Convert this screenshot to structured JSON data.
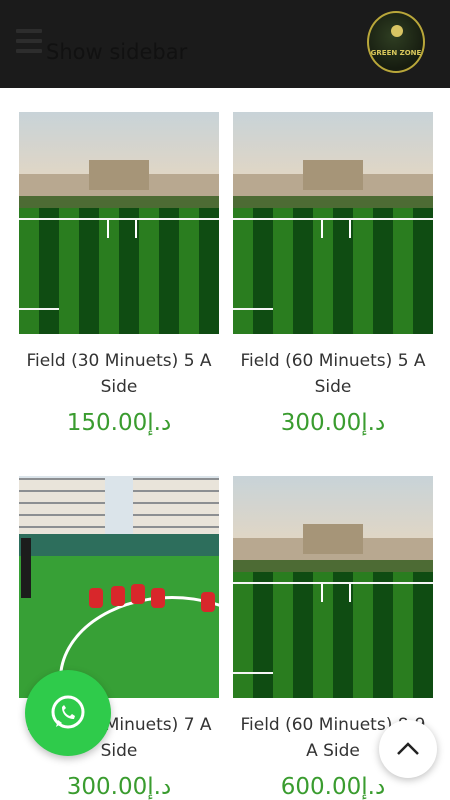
{
  "header": {
    "sidebar_label": "Show sidebar",
    "logo_text": "GREEN ZONE"
  },
  "products": [
    {
      "title": "Field (30 Minuets) 5 A Side",
      "price": "150.00د.إ"
    },
    {
      "title": "Field (60 Minuets) 5 A Side",
      "price": "300.00د.إ"
    },
    {
      "title": "Field (30 Minuets) 7 A Side",
      "price": "300.00د.إ"
    },
    {
      "title": "Field (60 Minuets) 8-9 A Side",
      "price": "600.00د.إ"
    }
  ],
  "colors": {
    "header_bg": "#1b1b1b",
    "price": "#3a9c2f",
    "whatsapp": "#2fcb4b"
  },
  "icons": {
    "menu": "hamburger-icon",
    "chat": "whatsapp-icon",
    "scroll": "chevron-up-icon"
  }
}
